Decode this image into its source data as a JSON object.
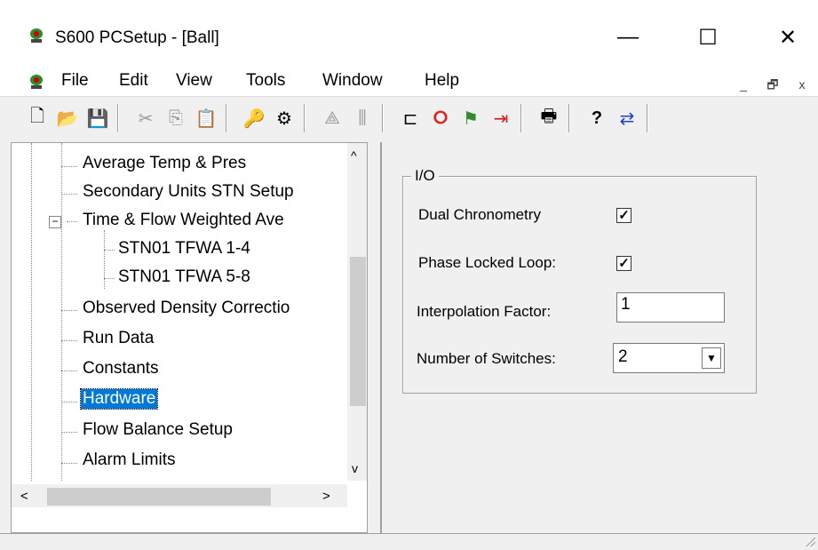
{
  "window": {
    "title": "S600 PCSetup  - [Ball]",
    "controls": {
      "minimize": "—",
      "maximize": "☐",
      "close": "✕"
    }
  },
  "menu": {
    "items": [
      "File",
      "Edit",
      "View",
      "Tools",
      "Window",
      "Help"
    ],
    "mdi_controls": {
      "minimize": "_",
      "restore": "🗗",
      "close": "x"
    }
  },
  "toolbar": {
    "buttons": [
      {
        "icon": "new-file-icon",
        "glyph": "🗋"
      },
      {
        "icon": "open-folder-icon",
        "glyph": "📂"
      },
      {
        "icon": "save-icon",
        "glyph": "💾"
      },
      {
        "icon": "cut-icon",
        "glyph": "✂"
      },
      {
        "icon": "copy-icon",
        "glyph": "⎘"
      },
      {
        "icon": "paste-icon",
        "glyph": "📋"
      },
      {
        "icon": "key-icon",
        "glyph": "🔑"
      },
      {
        "icon": "connect-icon",
        "glyph": "⚙"
      },
      {
        "icon": "network-icon",
        "glyph": "⟁"
      },
      {
        "icon": "sliders-icon",
        "glyph": "⫼"
      },
      {
        "icon": "plug-icon",
        "glyph": "⊏"
      },
      {
        "icon": "stop-circle-icon",
        "glyph": "⭘"
      },
      {
        "icon": "signal-icon",
        "glyph": "⚑"
      },
      {
        "icon": "transfer-icon",
        "glyph": "⇥"
      },
      {
        "icon": "print-icon",
        "glyph": "🖶"
      },
      {
        "icon": "help-icon",
        "glyph": "?"
      },
      {
        "icon": "swap-arrows-icon",
        "glyph": "⇄"
      }
    ],
    "colors": {
      "stop": "#e02020",
      "signal": "#d02020",
      "transfer": "#20a020",
      "swap": "#2040d0"
    }
  },
  "tree": {
    "items": [
      {
        "label": "Average Temp & Pres",
        "level": 1
      },
      {
        "label": "Secondary Units STN Setup",
        "level": 1
      },
      {
        "label": "Time & Flow Weighted Ave",
        "level": 1,
        "expanded": true
      },
      {
        "label": "STN01 TFWA 1-4",
        "level": 2
      },
      {
        "label": "STN01 TFWA 5-8",
        "level": 2
      },
      {
        "label": "Observed Density Correctio",
        "level": 1
      },
      {
        "label": "Run Data",
        "level": 1
      },
      {
        "label": "Constants",
        "level": 1
      },
      {
        "label": "Hardware",
        "level": 1,
        "selected": true
      },
      {
        "label": "Flow Balance Setup",
        "level": 1
      },
      {
        "label": "Alarm Limits",
        "level": 1
      }
    ],
    "selected_color": "#0078d7",
    "scroll_up": "^",
    "scroll_down": "v",
    "scroll_left": "<",
    "scroll_right": ">",
    "expander": "−"
  },
  "io": {
    "legend": "I/O",
    "dual_chronometry": {
      "label": "Dual Chronometry",
      "checked": true,
      "mark": "✓"
    },
    "phase_locked_loop": {
      "label": "Phase Locked Loop:",
      "checked": true,
      "mark": "✓"
    },
    "interpolation_factor": {
      "label": "Interpolation Factor:",
      "value": "1"
    },
    "number_of_switches": {
      "label": "Number of Switches:",
      "value": "2",
      "arrow": "▼"
    }
  }
}
